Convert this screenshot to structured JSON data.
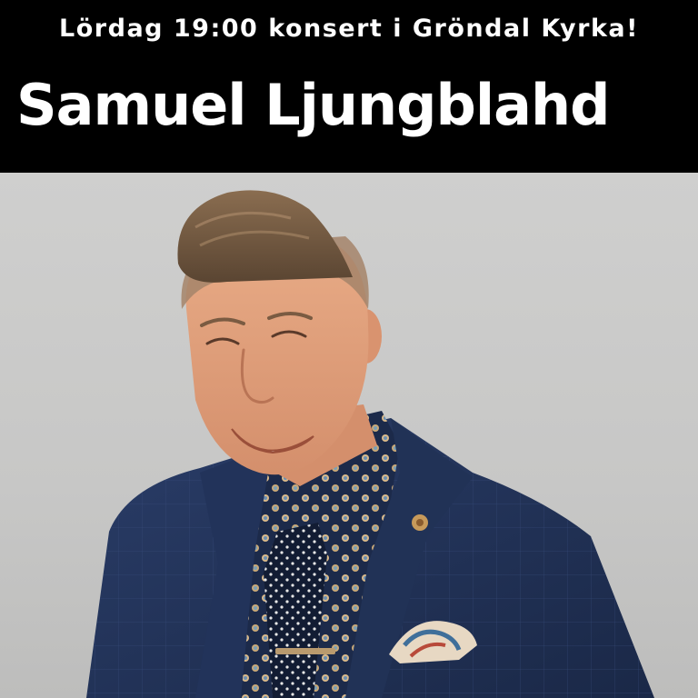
{
  "banner": {
    "subtitle": "Lördag 19:00 konsert i Gröndal Kyrka!",
    "headline": "Samuel Ljungblahd"
  },
  "photo": {
    "subject": "portrait"
  },
  "colors": {
    "banner_background": "#000000",
    "banner_text": "#ffffff",
    "photo_background": "#cbcbca",
    "suit": "#22335a",
    "skin": "#e2a07c",
    "hair": "#6e5640"
  }
}
